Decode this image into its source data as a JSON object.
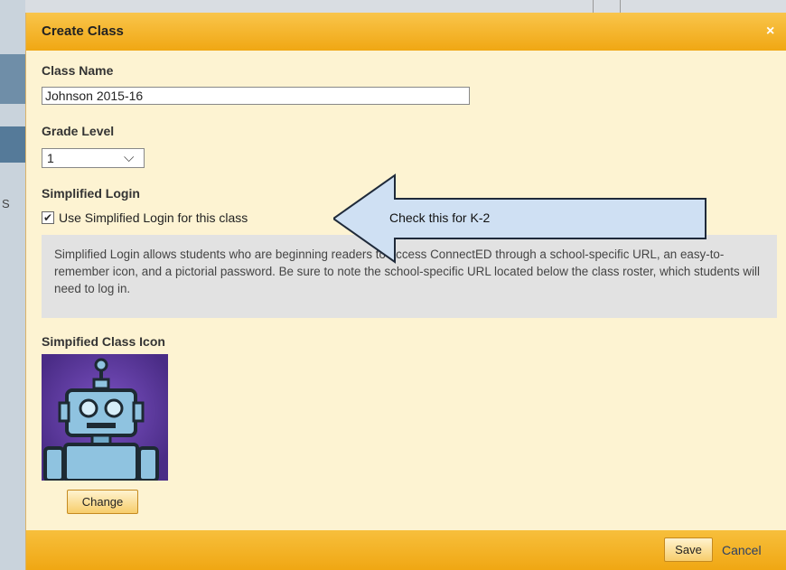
{
  "background": {
    "fragment_text": "S"
  },
  "dialog": {
    "title": "Create Class",
    "close_glyph": "×",
    "class_name": {
      "label": "Class Name",
      "value": "Johnson 2015-16"
    },
    "grade_level": {
      "label": "Grade Level",
      "selected": "1"
    },
    "simplified_login": {
      "heading": "Simplified Login",
      "checkbox_label": "Use Simplified Login for this class",
      "checked": true,
      "info": "Simplified Login allows students who are beginning readers to access ConnectED through a school-specific URL, an easy-to-remember icon, and a pictorial password. Be sure to note the school-specific URL located below the class roster, which students will need to log in."
    },
    "callout": {
      "text": "Check this for K-2"
    },
    "class_icon": {
      "label": "Simpified Class Icon",
      "icon": "robot-icon",
      "change_label": "Change"
    },
    "footer": {
      "save_label": "Save",
      "cancel_label": "Cancel"
    }
  },
  "colors": {
    "titlebar": "#f0a713",
    "dialog_bg": "#fdf3d2",
    "callout_fill": "#cfe0f3",
    "icon_bg": "#5a3a98"
  }
}
